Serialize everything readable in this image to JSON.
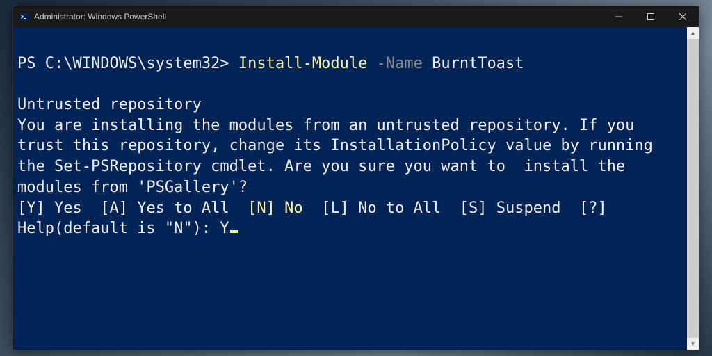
{
  "window": {
    "title": "Administrator: Windows PowerShell"
  },
  "terminal": {
    "prompt_prefix": "PS ",
    "prompt_path": "C:\\WINDOWS\\system32",
    "prompt_suffix": "> ",
    "command": "Install-Module",
    "param_flag": " -Name ",
    "param_value": "BurntToast",
    "warn_title": "Untrusted repository",
    "warn_body": "You are installing the modules from an untrusted repository. If you trust this repository, change its InstallationPolicy value by running the Set-PSRepository cmdlet. Are you sure you want to  install the modules from 'PSGallery'?",
    "opt_yes": "[Y] Yes  ",
    "opt_all": "[A] Yes to All  ",
    "opt_no": "[N] No",
    "opt_noall": "  [L] No to All  ",
    "opt_suspend": "[S] Suspend  ",
    "opt_help": "[?] Help(default is \"N\"): ",
    "user_input": "Y"
  }
}
